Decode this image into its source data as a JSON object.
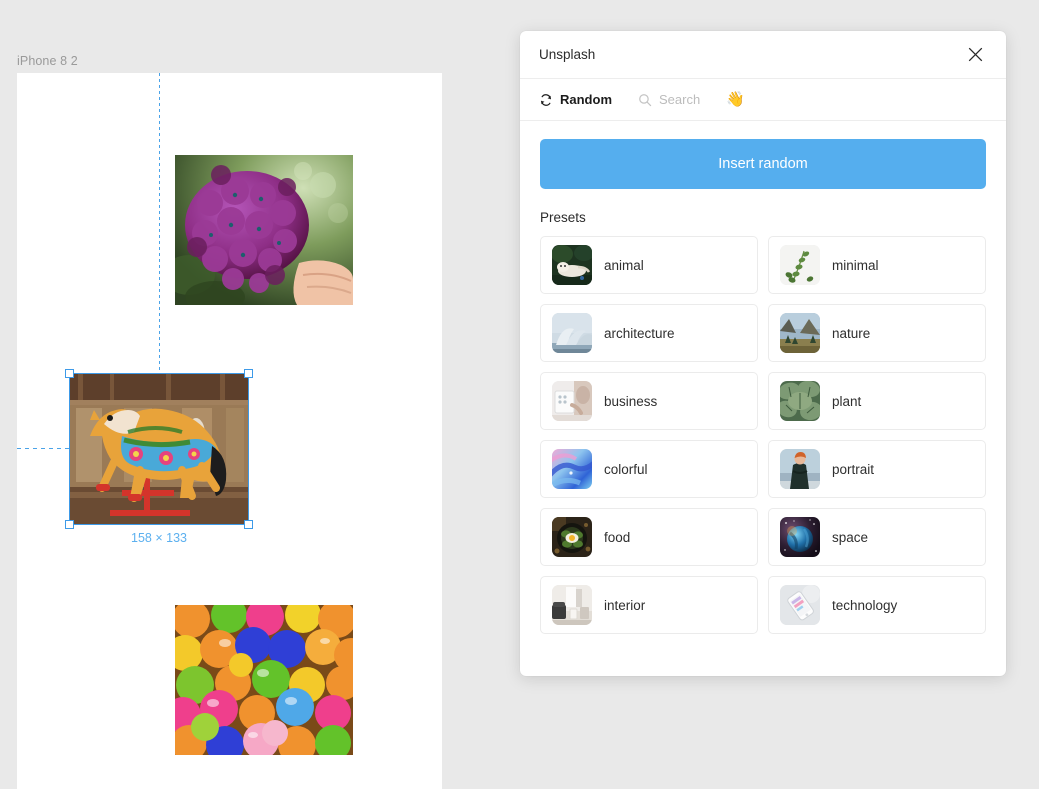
{
  "canvas": {
    "artboard_label": "iPhone 8 2",
    "selection": {
      "dimensions_label": "158 × 133",
      "selected_item": "carousel-horse-image"
    },
    "images": [
      {
        "name": "purple-hydrangea-flower-image"
      },
      {
        "name": "carousel-horse-image"
      },
      {
        "name": "colorful-plastic-balls-image"
      }
    ]
  },
  "panel": {
    "title": "Unsplash",
    "close_icon": "close-icon",
    "tabs": [
      {
        "label": "Random",
        "icon": "refresh-icon",
        "active": true
      },
      {
        "label": "Search",
        "icon": "search-icon",
        "active": false
      }
    ],
    "emoji_tab": "👋",
    "insert_button": "Insert random",
    "presets_heading": "Presets",
    "presets": [
      {
        "label": "animal",
        "thumb": "white-tiger-thumb"
      },
      {
        "label": "minimal",
        "thumb": "plant-sprig-thumb"
      },
      {
        "label": "architecture",
        "thumb": "opera-house-thumb"
      },
      {
        "label": "nature",
        "thumb": "valley-thumb"
      },
      {
        "label": "business",
        "thumb": "laptop-desk-thumb"
      },
      {
        "label": "plant",
        "thumb": "green-leaves-thumb"
      },
      {
        "label": "colorful",
        "thumb": "paint-swirl-thumb"
      },
      {
        "label": "portrait",
        "thumb": "person-standing-thumb"
      },
      {
        "label": "food",
        "thumb": "skillet-food-thumb"
      },
      {
        "label": "space",
        "thumb": "planet-thumb"
      },
      {
        "label": "interior",
        "thumb": "living-room-thumb"
      },
      {
        "label": "technology",
        "thumb": "smartphone-thumb"
      }
    ]
  },
  "colors": {
    "accent_blue": "#55aeee",
    "guide_blue": "#4aa3e8",
    "canvas_bg": "#e9e9e9",
    "panel_bg": "#ffffff"
  }
}
